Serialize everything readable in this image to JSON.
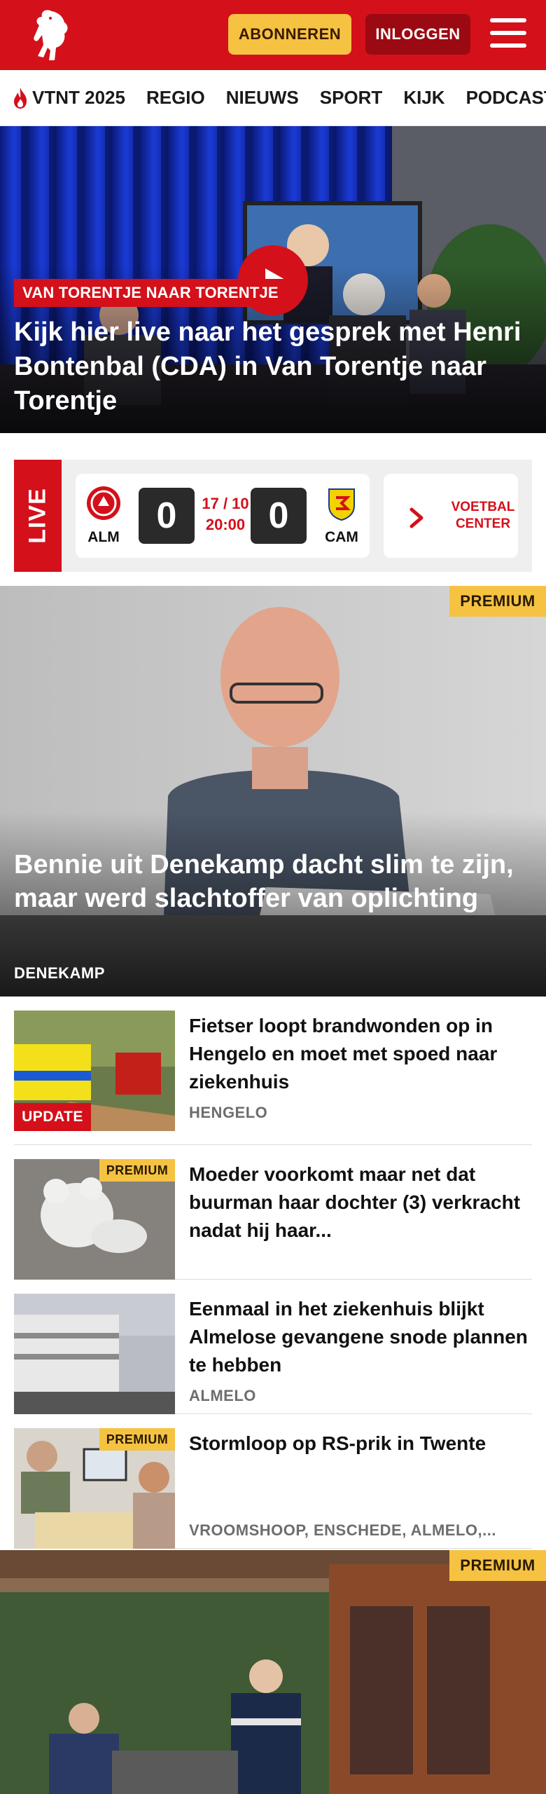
{
  "header": {
    "subscribe_label": "ABONNEREN",
    "login_label": "INLOGGEN",
    "brand_color": "#d4101a",
    "accent_color": "#f5c242"
  },
  "nav": {
    "items": [
      {
        "label": "VTNT 2025",
        "icon": "flame-icon"
      },
      {
        "label": "REGIO"
      },
      {
        "label": "NIEUWS"
      },
      {
        "label": "SPORT"
      },
      {
        "label": "KIJK"
      },
      {
        "label": "PODCAST"
      }
    ]
  },
  "hero": {
    "tag": "VAN TORENTJE NAAR TORENTJE",
    "title": "Kijk hier live naar het gesprek met Henri Bontenbal (CDA) in Van Torentje naar Torentje",
    "icon": "play-icon"
  },
  "live": {
    "label": "LIVE",
    "match": {
      "home": "ALM",
      "away": "CAM",
      "home_score": "0",
      "away_score": "0",
      "date": "17 / 10",
      "time": "20:00"
    },
    "voetbalcenter_line1": "VOETBAL",
    "voetbalcenter_line2": "CENTER"
  },
  "feature": {
    "badge": "PREMIUM",
    "title": "Bennie uit Denekamp dacht slim te zijn, maar werd slachtoffer van oplichting",
    "location": "DENEKAMP"
  },
  "articles": [
    {
      "title": "Fietser loopt brandwonden op in Hengelo en moet met spoed naar ziekenhuis",
      "location": "HENGELO",
      "badge": "UPDATE"
    },
    {
      "title": "Moeder voorkomt maar net dat buurman haar dochter (3) verkracht nadat hij haar...",
      "location": "",
      "badge": "PREMIUM"
    },
    {
      "title": "Eenmaal in het ziekenhuis blijkt Almelose gevangene snode plannen te hebben",
      "location": "ALMELO",
      "badge": ""
    },
    {
      "title": "Stormloop op RS-prik in Twente",
      "location": "VROOMSHOOP, ENSCHEDE, ALMELO,...",
      "badge": "PREMIUM"
    }
  ],
  "bottom_feature": {
    "badge": "PREMIUM"
  }
}
